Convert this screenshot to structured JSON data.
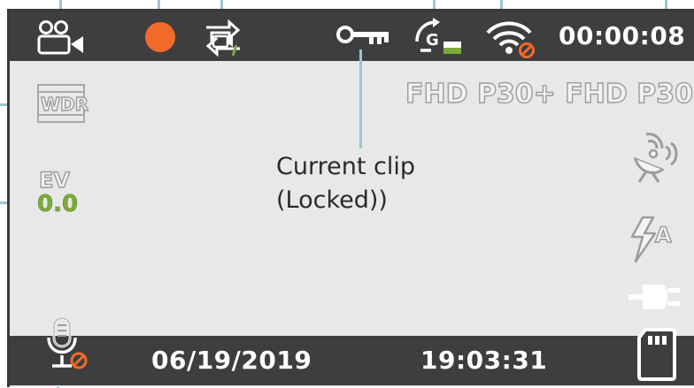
{
  "status_bar": {
    "timer": "00:00:08",
    "record_color": "#f26a2a"
  },
  "resolution": {
    "primary": "FHD P30+",
    "secondary": "FHD P30"
  },
  "wdr": {
    "label": "WDR"
  },
  "exposure": {
    "label": "EV",
    "value": "0.0",
    "value_color": "#7cab3b"
  },
  "annotation": {
    "line1": "Current clip",
    "line2": "(Locked))"
  },
  "bottom_bar": {
    "date": "06/19/2019",
    "time": "19:03:31"
  },
  "icons": {
    "camera_mode": "dual-camera-icon",
    "recording": "recording-dot-icon",
    "loop": "loop-recording-icon",
    "lock": "key-icon",
    "gsensor": "g-sensor-icon",
    "wifi": "wifi-off-icon",
    "satellite": "gps-satellite-icon",
    "flash": "auto-flash-icon",
    "power": "power-plug-icon",
    "microphone": "microphone-off-icon",
    "sdcard": "sd-card-icon"
  },
  "colors": {
    "callout": "#9dc4d3",
    "bar": "#3e3e3e",
    "screen": "#e8e8e8",
    "accent_green": "#7cab3b",
    "warning": "#f26a2a"
  }
}
